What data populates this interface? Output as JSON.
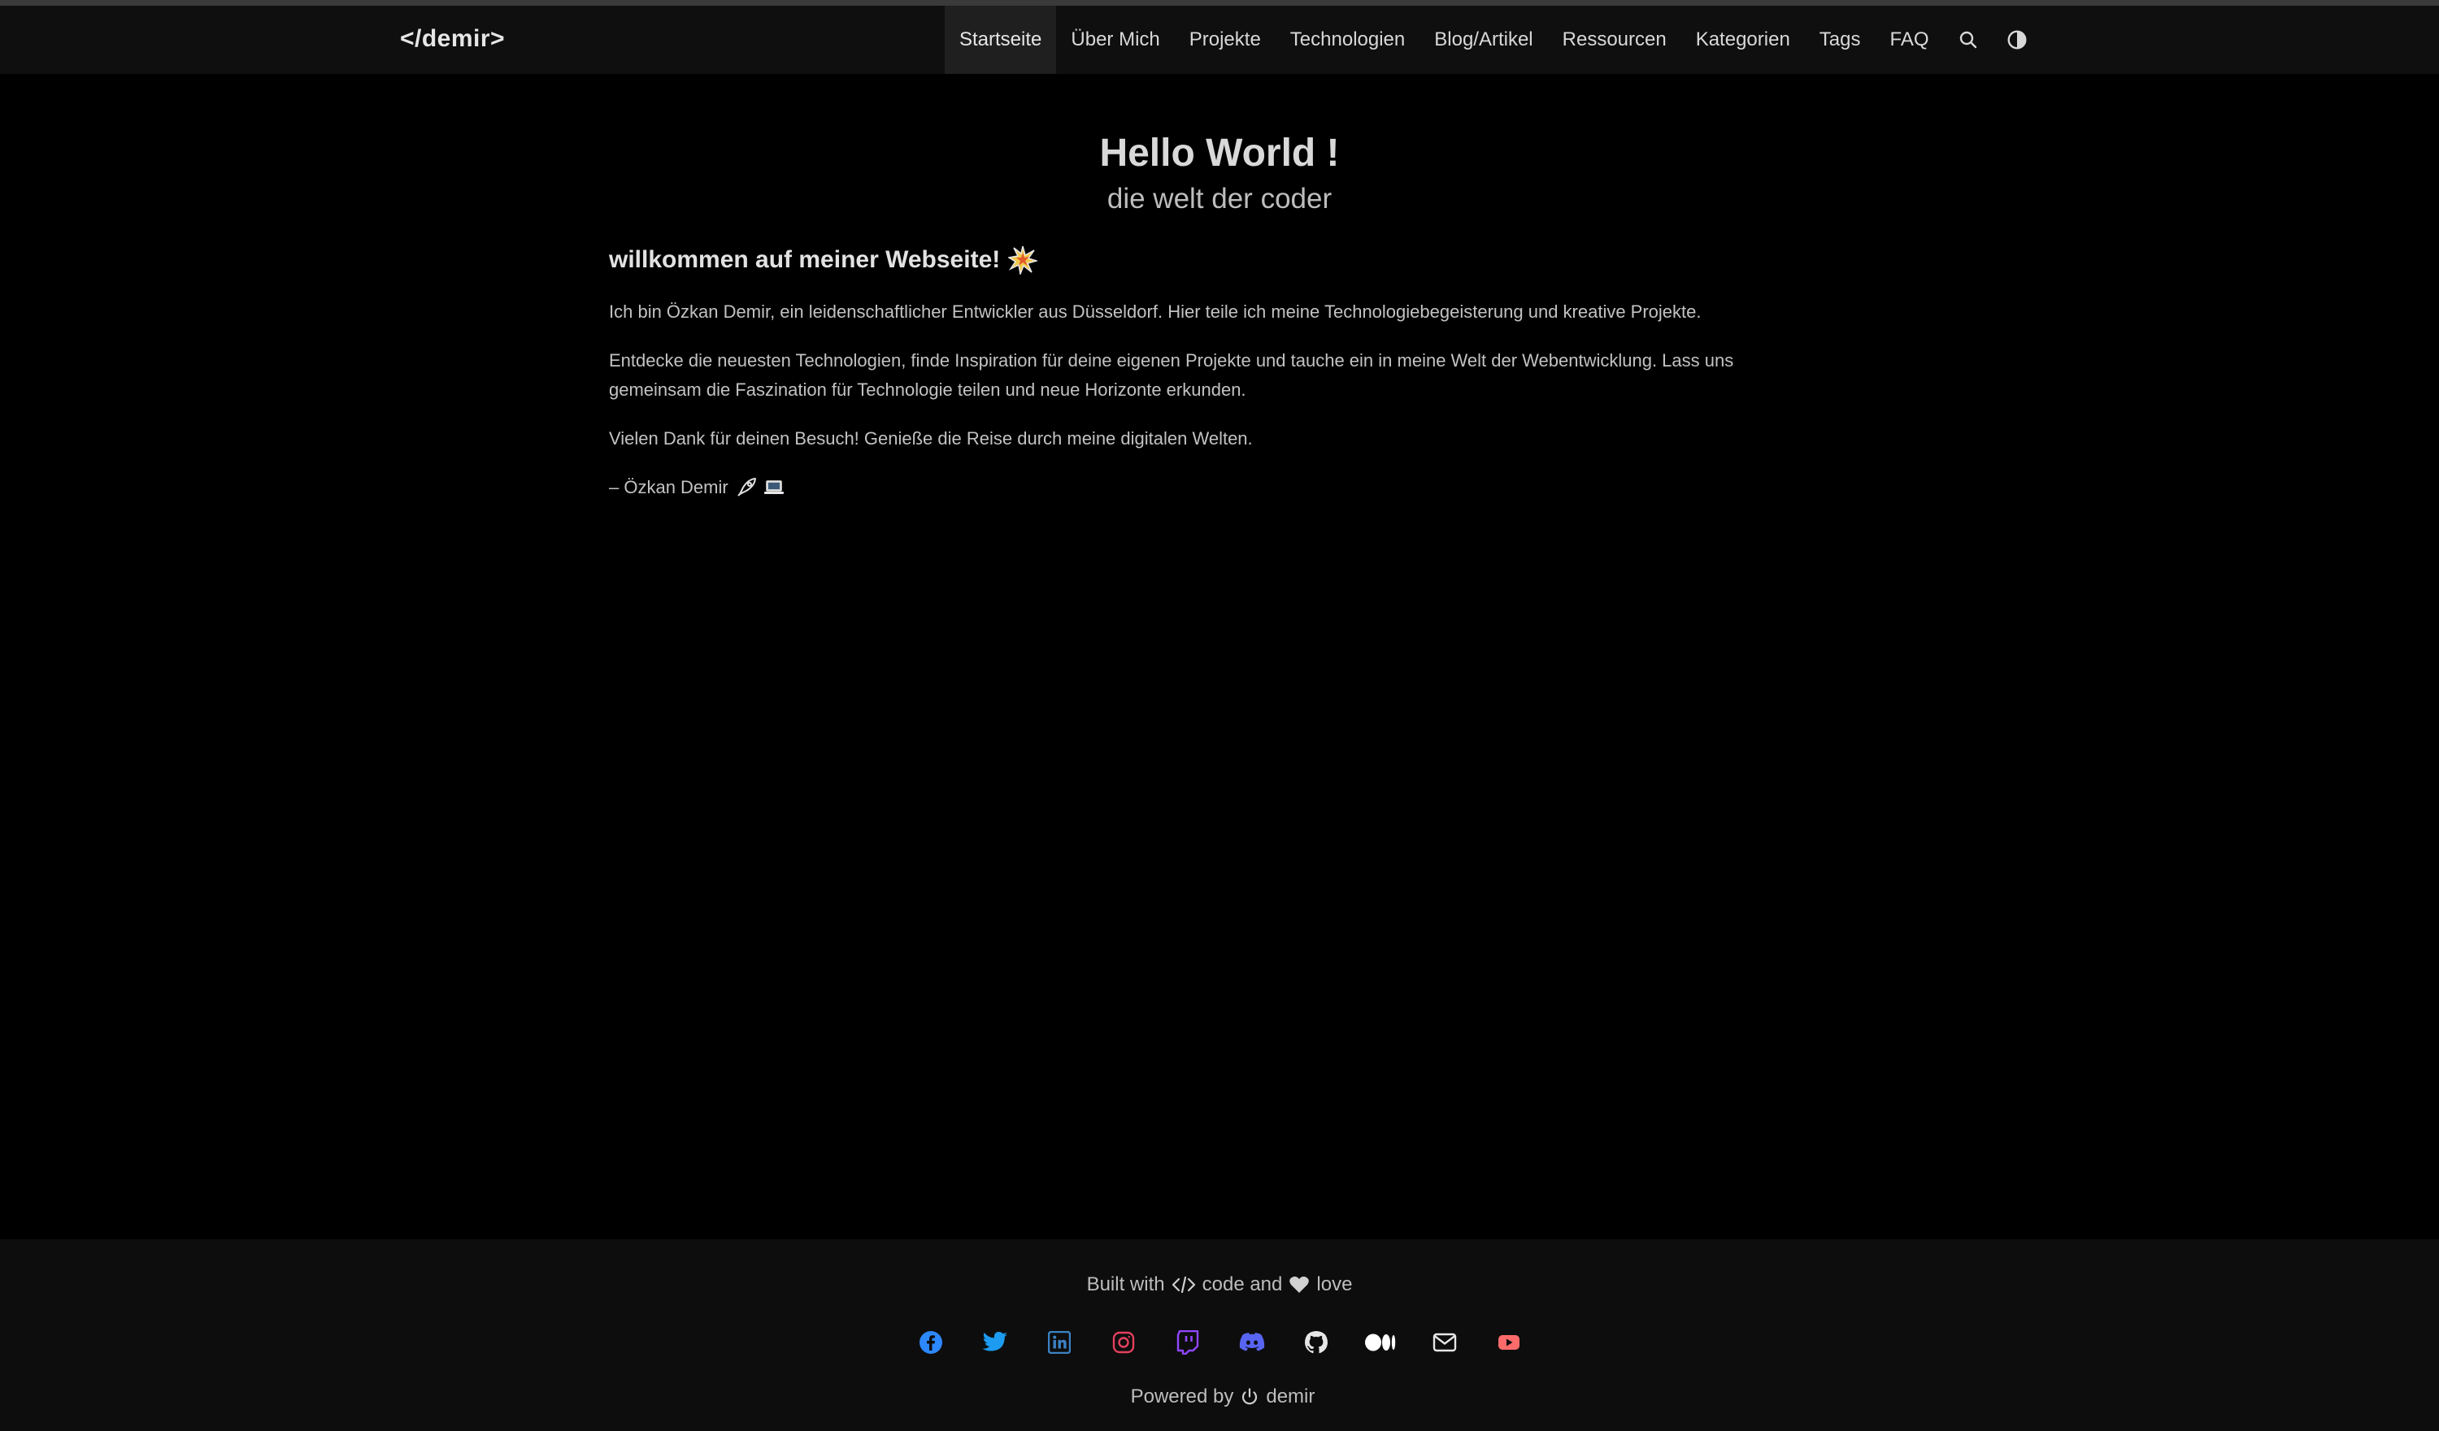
{
  "header": {
    "brand": "</demir>",
    "nav": [
      {
        "label": "Startseite",
        "active": true
      },
      {
        "label": "Über Mich"
      },
      {
        "label": "Projekte"
      },
      {
        "label": "Technologien"
      },
      {
        "label": "Blog/Artikel"
      },
      {
        "label": "Ressourcen"
      },
      {
        "label": "Kategorien"
      },
      {
        "label": "Tags"
      },
      {
        "label": "FAQ"
      }
    ],
    "icons": [
      "search-icon",
      "theme-toggle-icon"
    ]
  },
  "hero": {
    "title": "Hello World !",
    "subtitle": "die welt der coder"
  },
  "content": {
    "heading": "willkommen auf meiner Webseite!",
    "heading_icon": "sparkle-emoji",
    "paragraphs": [
      "Ich bin Özkan Demir, ein leidenschaftlicher Entwickler aus Düsseldorf. Hier teile ich meine Technologiebegeisterung und kreative Projekte.",
      "Entdecke die neuesten Technologien, finde Inspiration für deine eigenen Projekte und tauche ein in meine Welt der Webentwicklung. Lass uns gemeinsam die Faszination für Technologie teilen und neue Horizonte erkunden.",
      "Vielen Dank für deinen Besuch! Genieße die Reise durch meine digitalen Welten."
    ],
    "signature": "– Özkan Demir",
    "signature_icons": [
      "rocket-icon",
      "laptop-icon"
    ]
  },
  "footer": {
    "built_prefix": "Built with",
    "built_middle": "code and",
    "built_suffix": "love",
    "socials": [
      {
        "name": "facebook-icon",
        "color": "#2d88ff"
      },
      {
        "name": "twitter-icon",
        "color": "#1d9bf0"
      },
      {
        "name": "linkedin-icon",
        "color": "#3b82c4"
      },
      {
        "name": "instagram-icon",
        "color": "#e4405f"
      },
      {
        "name": "twitch-icon",
        "color": "#9146ff"
      },
      {
        "name": "discord-icon",
        "color": "#5865f2"
      },
      {
        "name": "github-icon",
        "color": "#e6e6e6"
      },
      {
        "name": "medium-icon",
        "color": "#ffffff"
      },
      {
        "name": "email-icon",
        "color": "#e6e6e6"
      },
      {
        "name": "youtube-icon",
        "color": "#ff6b6b"
      }
    ],
    "powered_prefix": "Powered by",
    "powered_name": "demir"
  },
  "colors": {
    "background": "#000000",
    "navbar": "#0f0f0f",
    "active_nav": "#1f1f1f",
    "footer": "#0d0d0d",
    "text": "#cfcfcf"
  }
}
